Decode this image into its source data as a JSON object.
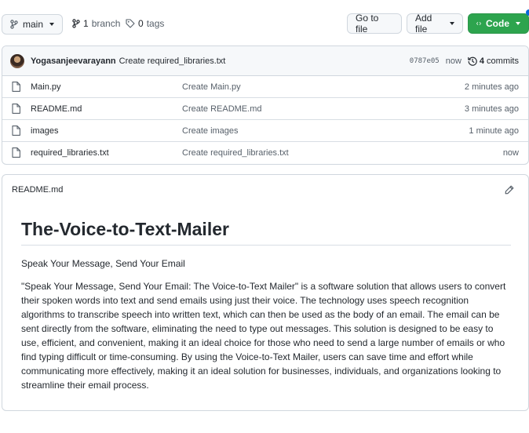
{
  "toolbar": {
    "branch_label": "main",
    "branches_count": "1",
    "branches_label": "branch",
    "tags_count": "0",
    "tags_label": "tags",
    "goto_file_label": "Go to file",
    "add_file_label": "Add file",
    "code_label": "Code"
  },
  "commit": {
    "author": "Yogasanjeevarayann",
    "message": "Create required_libraries.txt",
    "sha": "0787e05",
    "time": "now",
    "commits_count": "4",
    "commits_label": "commits"
  },
  "files": [
    {
      "name": "Main.py",
      "message": "Create Main.py",
      "time": "2 minutes ago"
    },
    {
      "name": "README.md",
      "message": "Create README.md",
      "time": "3 minutes ago"
    },
    {
      "name": "images",
      "message": "Create images",
      "time": "1 minute ago"
    },
    {
      "name": "required_libraries.txt",
      "message": "Create required_libraries.txt",
      "time": "now"
    }
  ],
  "readme": {
    "filename": "README.md",
    "title": "The-Voice-to-Text-Mailer",
    "subtitle": "Speak Your Message, Send Your Email",
    "body": "\"Speak Your Message, Send Your Email: The Voice-to-Text Mailer\" is a software solution that allows users to convert their spoken words into text and send emails using just their voice. The technology uses speech recognition algorithms to transcribe speech into written text, which can then be used as the body of an email. The email can be sent directly from the software, eliminating the need to type out messages. This solution is designed to be easy to use, efficient, and convenient, making it an ideal choice for those who need to send a large number of emails or who find typing difficult or time-consuming. By using the Voice-to-Text Mailer, users can save time and effort while communicating more effectively, making it an ideal solution for businesses, individuals, and organizations looking to streamline their email process."
  },
  "colors": {
    "code_button": "#2da44e",
    "border": "#d0d7de",
    "muted_text": "#57606a"
  },
  "icons": [
    "branch-icon",
    "git-branch-icon",
    "tag-icon",
    "code-icon",
    "history-icon",
    "file-icon",
    "pencil-icon"
  ]
}
